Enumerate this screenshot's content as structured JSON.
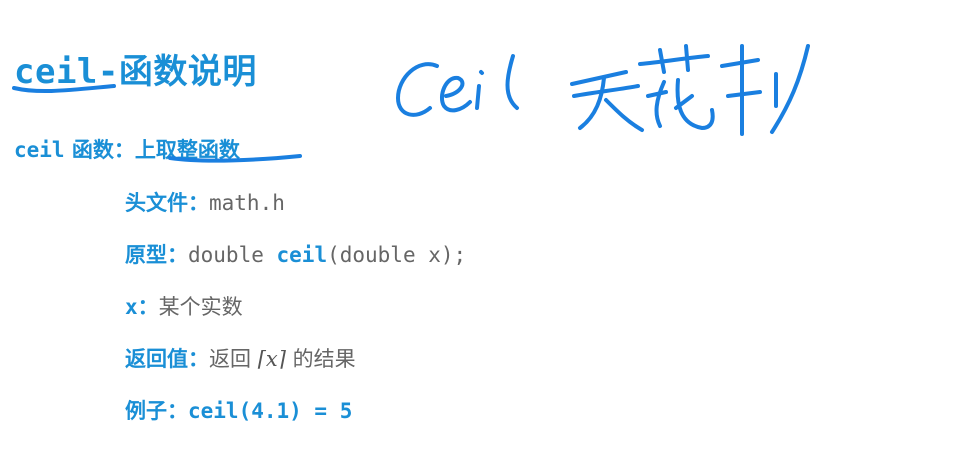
{
  "title": {
    "func": "ceil-",
    "rest": "函数说明"
  },
  "definition": {
    "func": "ceil",
    "label": " 函数：",
    "value": "上取整函数"
  },
  "header_file": {
    "label": "头文件：",
    "value": "math.h"
  },
  "prototype": {
    "label": "原型：",
    "before": "double ",
    "func": "ceil",
    "after": "(double x);"
  },
  "param": {
    "label": "x",
    "sep": "：",
    "value": "某个实数"
  },
  "return": {
    "label": "返回值：",
    "prefix": "返回 ",
    "expr": "⌈x⌉",
    "suffix": " 的结果"
  },
  "example": {
    "label": "例子：",
    "value": "ceil(4.1) = 5"
  },
  "handwriting": {
    "text": "ceil 天花板",
    "color": "#1a7fe0"
  }
}
